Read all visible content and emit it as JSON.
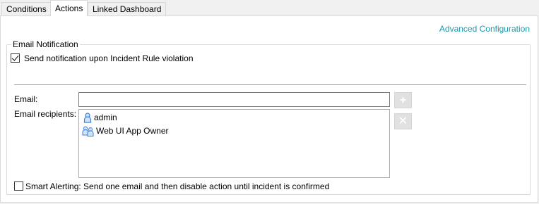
{
  "tabs": [
    {
      "label": "Conditions",
      "active": false
    },
    {
      "label": "Actions",
      "active": true
    },
    {
      "label": "Linked Dashboard",
      "active": false
    }
  ],
  "advanced_link": "Advanced Configuration",
  "email_group": {
    "title": "Email Notification",
    "send_notification": {
      "label": "Send notification upon Incident Rule violation",
      "checked": true
    },
    "email_label": "Email:",
    "email_value": "",
    "recipients_label": "Email recipients:",
    "recipients": [
      {
        "name": "admin",
        "icon": "user-icon"
      },
      {
        "name": "Web UI App Owner",
        "icon": "group-icon"
      }
    ],
    "add_icon": "plus-icon",
    "remove_icon": "x-icon",
    "smart_alerting": {
      "label": "Smart Alerting: Send one email and then disable action until incident is confirmed",
      "checked": false
    }
  },
  "colors": {
    "link": "#1a9bb0",
    "border": "#d9d9d9",
    "user_icon": "#3d7fd6"
  }
}
